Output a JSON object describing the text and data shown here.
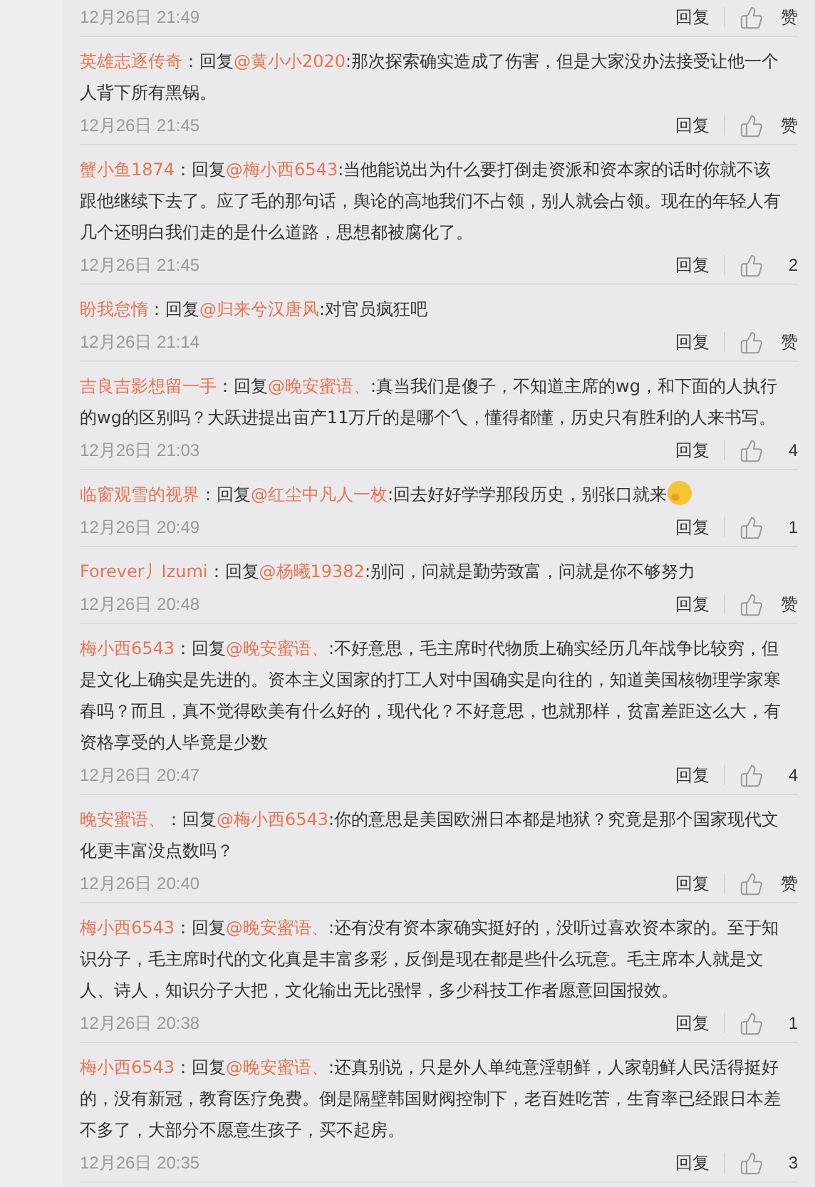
{
  "top_meta": {
    "time": "12月26日 21:49",
    "reply_label": "回复",
    "like_label": "赞"
  },
  "comments": [
    {
      "author": "英雄志逐传奇",
      "prefix": "：回复",
      "mention": "@黄小小2020",
      "text": ":那次探索确实造成了伤害，但是大家没办法接受让他一个人背下所有黑锅。",
      "time": "12月26日 21:45",
      "reply_label": "回复",
      "like_label": "赞"
    },
    {
      "author": "蟹小鱼1874",
      "prefix": "：回复",
      "mention": "@梅小西6543",
      "text": ":当他能说出为什么要打倒走资派和资本家的话时你就不该跟他继续下去了。应了毛的那句话，舆论的高地我们不占领，别人就会占领。现在的年轻人有几个还明白我们走的是什么道路，思想都被腐化了。",
      "time": "12月26日 21:45",
      "reply_label": "回复",
      "like_label": "2"
    },
    {
      "author": "盼我怠惰",
      "prefix": "：回复",
      "mention": "@归来兮汉唐风",
      "text": ":对官员疯狂吧",
      "time": "12月26日 21:14",
      "reply_label": "回复",
      "like_label": "赞"
    },
    {
      "author": "吉良吉影想留一手",
      "prefix": "：回复",
      "mention": "@晚安蜜语、",
      "text": ":真当我们是傻子，不知道主席的wg，和下面的人执行的wg的区别吗？大跃进提出亩产11万斤的是哪个乀，懂得都懂，历史只有胜利的人来书写。",
      "time": "12月26日 21:03",
      "reply_label": "回复",
      "like_label": "4"
    },
    {
      "author": "临窗观雪的视界",
      "prefix": "：回复",
      "mention": "@红尘中凡人一枚",
      "text": ":回去好好学学那段历史，别张口就来",
      "emoji": true,
      "time": "12月26日 20:49",
      "reply_label": "回复",
      "like_label": "1"
    },
    {
      "author": "Forever丿Izumi",
      "prefix": "：回复",
      "mention": "@杨曦19382",
      "text": ":别问，问就是勤劳致富，问就是你不够努力",
      "time": "12月26日 20:48",
      "reply_label": "回复",
      "like_label": "赞"
    },
    {
      "author": "梅小西6543",
      "prefix": "：回复",
      "mention": "@晚安蜜语、",
      "text": ":不好意思，毛主席时代物质上确实经历几年战争比较穷，但是文化上确实是先进的。资本主义国家的打工人对中国确实是向往的，知道美国核物理学家寒春吗？而且，真不觉得欧美有什么好的，现代化？不好意思，也就那样，贫富差距这么大，有资格享受的人毕竟是少数",
      "time": "12月26日 20:47",
      "reply_label": "回复",
      "like_label": "4"
    },
    {
      "author": "晚安蜜语、",
      "prefix": "：回复",
      "mention": "@梅小西6543",
      "text": ":你的意思是美国欧洲日本都是地狱？究竟是那个国家现代文化更丰富没点数吗？",
      "time": "12月26日 20:40",
      "reply_label": "回复",
      "like_label": "赞"
    },
    {
      "author": "梅小西6543",
      "prefix": "：回复",
      "mention": "@晚安蜜语、",
      "text": ":还有没有资本家确实挺好的，没听过喜欢资本家的。至于知识分子，毛主席时代的文化真是丰富多彩，反倒是现在都是些什么玩意。毛主席本人就是文人、诗人，知识分子大把，文化输出无比强悍，多少科技工作者愿意回国报效。",
      "time": "12月26日 20:38",
      "reply_label": "回复",
      "like_label": "1"
    },
    {
      "author": "梅小西6543",
      "prefix": "：回复",
      "mention": "@晚安蜜语、",
      "text": ":还真别说，只是外人单纯意淫朝鲜，人家朝鲜人民活得挺好的，没有新冠，教育医疗免费。倒是隔壁韩国财阀控制下，老百姓吃苦，生育率已经跟日本差不多了，大部分不愿意生孩子，买不起房。",
      "time": "12月26日 20:35",
      "reply_label": "回复",
      "like_label": "3"
    }
  ]
}
